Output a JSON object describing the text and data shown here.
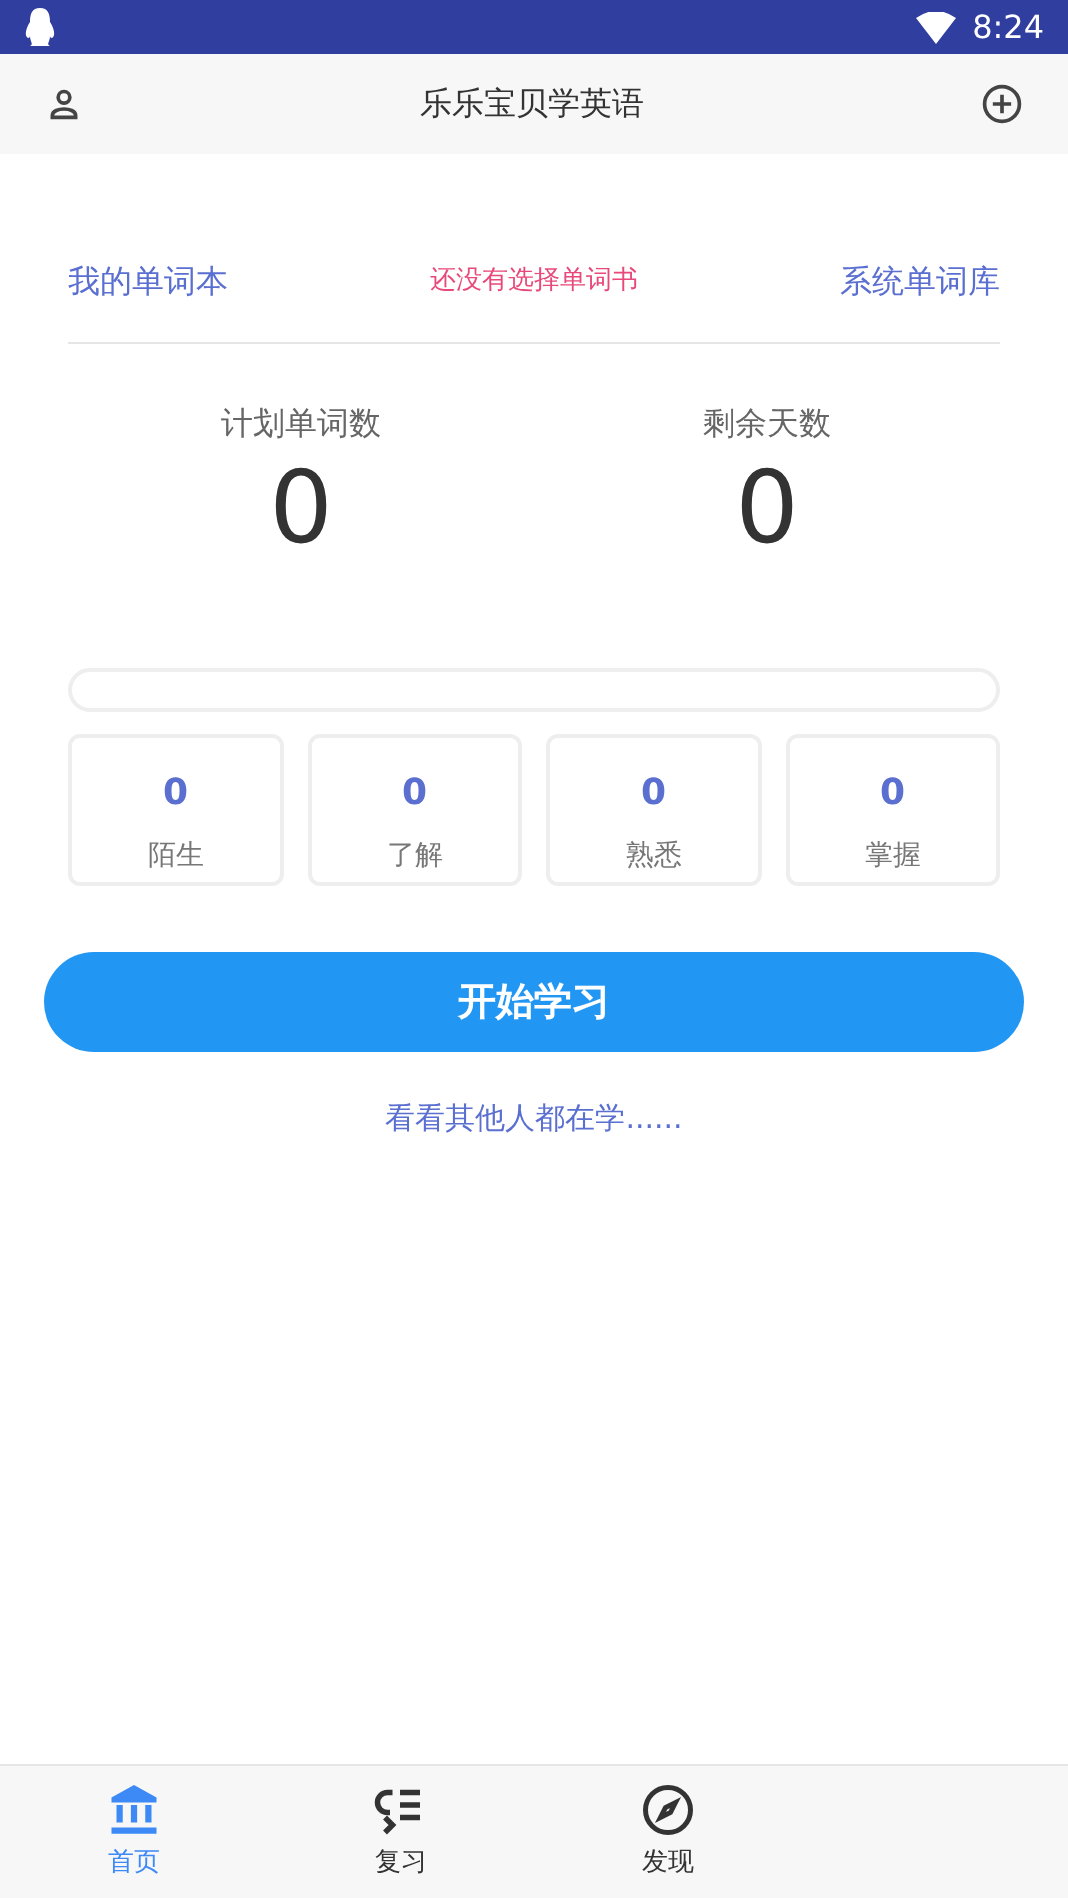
{
  "status_bar": {
    "time": "8:24"
  },
  "app_bar": {
    "title": "乐乐宝贝学英语"
  },
  "book_row": {
    "left_link": "我的单词本",
    "notice": "还没有选择单词书",
    "right_link": "系统单词库"
  },
  "stats": [
    {
      "label": "计划单词数",
      "value": "0"
    },
    {
      "label": "剩余天数",
      "value": "0"
    }
  ],
  "progress": {
    "level": 0
  },
  "levels": [
    {
      "count": "0",
      "label": "陌生"
    },
    {
      "count": "0",
      "label": "了解"
    },
    {
      "count": "0",
      "label": "熟悉"
    },
    {
      "count": "0",
      "label": "掌握"
    }
  ],
  "start_button": "开始学习",
  "others_link": "看看其他人都在学......",
  "bottom_nav": [
    {
      "kind": "home",
      "label": "首页",
      "selected": true
    },
    {
      "kind": "review",
      "label": "复习",
      "selected": false
    },
    {
      "kind": "discover",
      "label": "发现",
      "selected": false
    }
  ]
}
